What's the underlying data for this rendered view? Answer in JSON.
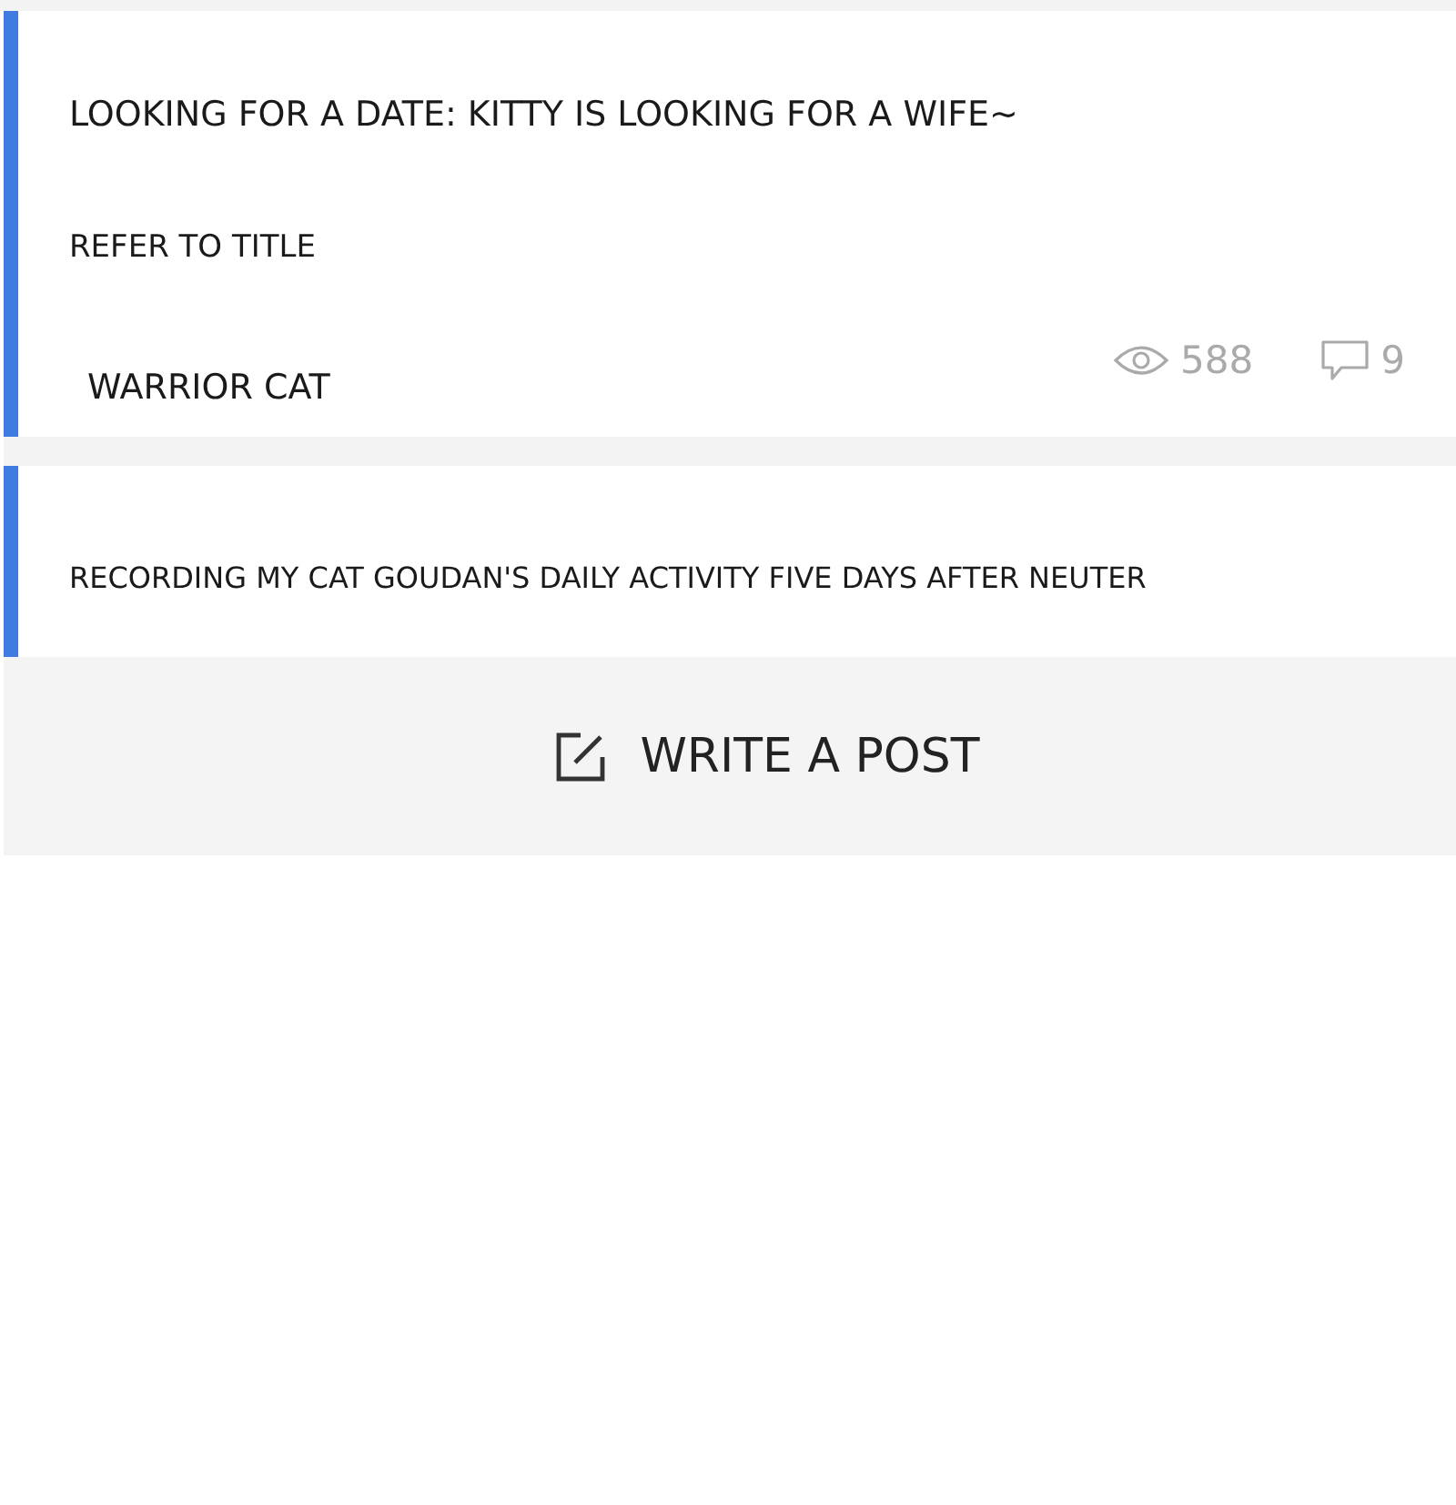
{
  "posts": [
    {
      "title": "LOOKING FOR A DATE: KITTY IS LOOKING FOR A WIFE~",
      "excerpt": "REFER TO TITLE",
      "tag": "WARRIOR CAT",
      "views": "588",
      "comments": "9"
    },
    {
      "title": "RECORDING MY CAT GOUDAN'S DAILY ACTIVITY FIVE DAYS AFTER NEUTER"
    }
  ],
  "write_button": {
    "label": "WRITE A POST"
  }
}
